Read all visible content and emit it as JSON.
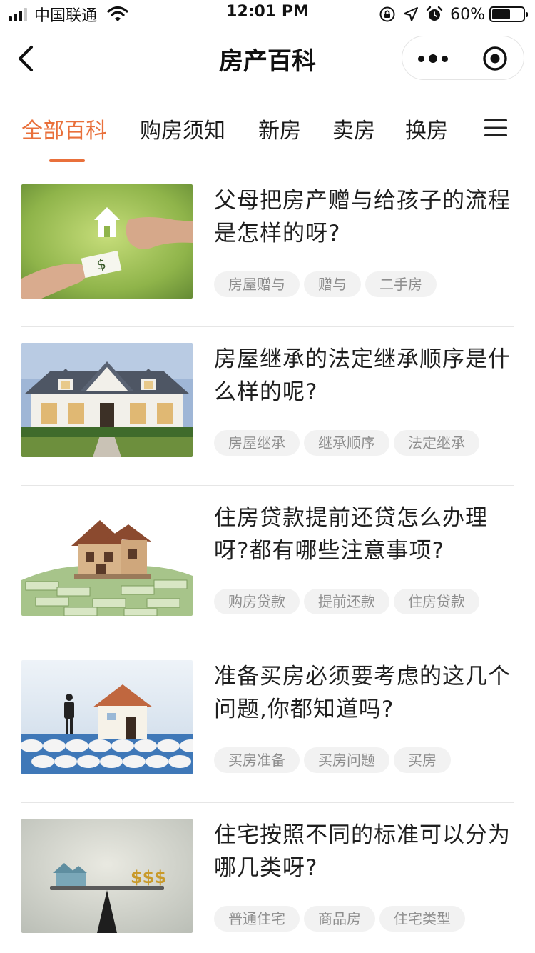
{
  "status_bar": {
    "carrier": "中国联通",
    "time": "12:01 PM",
    "battery_percent": "60%",
    "battery_level": 0.6,
    "icons": [
      "signal-icon",
      "wifi-icon",
      "orientation-lock-icon",
      "location-icon",
      "alarm-icon",
      "battery-icon"
    ]
  },
  "nav": {
    "title": "房产百科",
    "icons": [
      "back-icon",
      "more-icon",
      "close-icon"
    ]
  },
  "tabs": [
    {
      "label": "全部百科",
      "active": true
    },
    {
      "label": "购房须知",
      "active": false
    },
    {
      "label": "新房",
      "active": false
    },
    {
      "label": "卖房",
      "active": false
    },
    {
      "label": "换房",
      "active": false
    }
  ],
  "accent_color": "#e9703b",
  "articles": [
    {
      "title": "父母把房产赠与给孩子的流程是怎样的呀?",
      "tags": [
        "房屋赠与",
        "赠与",
        "二手房"
      ],
      "image": "hands-house-money"
    },
    {
      "title": "房屋继承的法定继承顺序是什么样的呢?",
      "tags": [
        "房屋继承",
        "继承顺序",
        "法定继承"
      ],
      "image": "white-house"
    },
    {
      "title": "住房贷款提前还贷怎么办理呀?都有哪些注意事项?",
      "tags": [
        "购房贷款",
        "提前还款",
        "住房贷款"
      ],
      "image": "house-on-money"
    },
    {
      "title": "准备买房必须要考虑的这几个问题,你都知道吗?",
      "tags": [
        "买房准备",
        "买房问题",
        "买房"
      ],
      "image": "abacus-house-man"
    },
    {
      "title": "住宅按照不同的标准可以分为哪几类呀?",
      "tags": [
        "普通住宅",
        "商品房",
        "住宅类型"
      ],
      "image": "seesaw-house-money"
    }
  ]
}
